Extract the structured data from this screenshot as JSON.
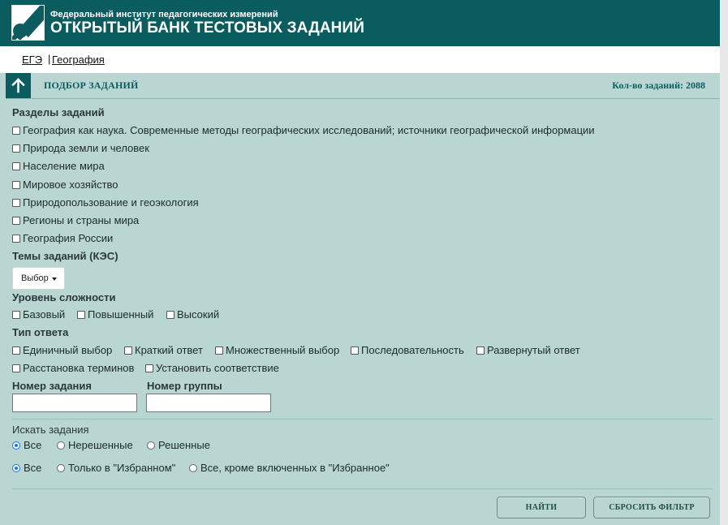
{
  "header": {
    "org_name": "Федеральный институт педагогических измерений",
    "bank_title": "ОТКРЫТЫЙ БАНК ТЕСТОВЫХ ЗАДАНИЙ"
  },
  "breadcrumb": {
    "items": [
      "ЕГЭ",
      "География"
    ],
    "separator": "|"
  },
  "panel": {
    "title": "ПОДБОР ЗАДАНИЙ",
    "count_label": "Кол-во заданий: 2088"
  },
  "sections": {
    "label": "Разделы заданий",
    "items": [
      "География как наука. Современные методы географических исследований; источники географической информации",
      "Природа земли и человек",
      "Население мира",
      "Мировое хозяйство",
      "Природопользование и геоэкология",
      "Регионы и страны мира",
      "География России"
    ]
  },
  "topics": {
    "label": "Темы заданий (КЭС)",
    "select_label": "Выбор"
  },
  "difficulty": {
    "label": "Уровень сложности",
    "items": [
      "Базовый",
      "Повышенный",
      "Высокий"
    ]
  },
  "answer_type": {
    "label": "Тип ответа",
    "items": [
      "Единичный выбор",
      "Краткий ответ",
      "Множественный выбор",
      "Последовательность",
      "Развернутый ответ",
      "Расстановка терминов",
      "Установить соответствие"
    ]
  },
  "fields": {
    "task_number_label": "Номер задания",
    "task_number_value": "",
    "group_number_label": "Номер группы",
    "group_number_value": ""
  },
  "search": {
    "label": "Искать задания",
    "status_options": [
      "Все",
      "Нерешенные",
      "Решенные"
    ],
    "status_selected": "Все",
    "favorites_options": [
      "Все",
      "Только в \"Избранном\"",
      "Все, кроме включенных в \"Избранное\""
    ],
    "favorites_selected": "Все"
  },
  "buttons": {
    "find": "НАЙТИ",
    "reset": "СБРОСИТЬ ФИЛЬТР"
  },
  "colors": {
    "brand": "#0b5c5e",
    "panel_bg": "#b9d6d3",
    "radio_accent": "#1a73e8"
  }
}
